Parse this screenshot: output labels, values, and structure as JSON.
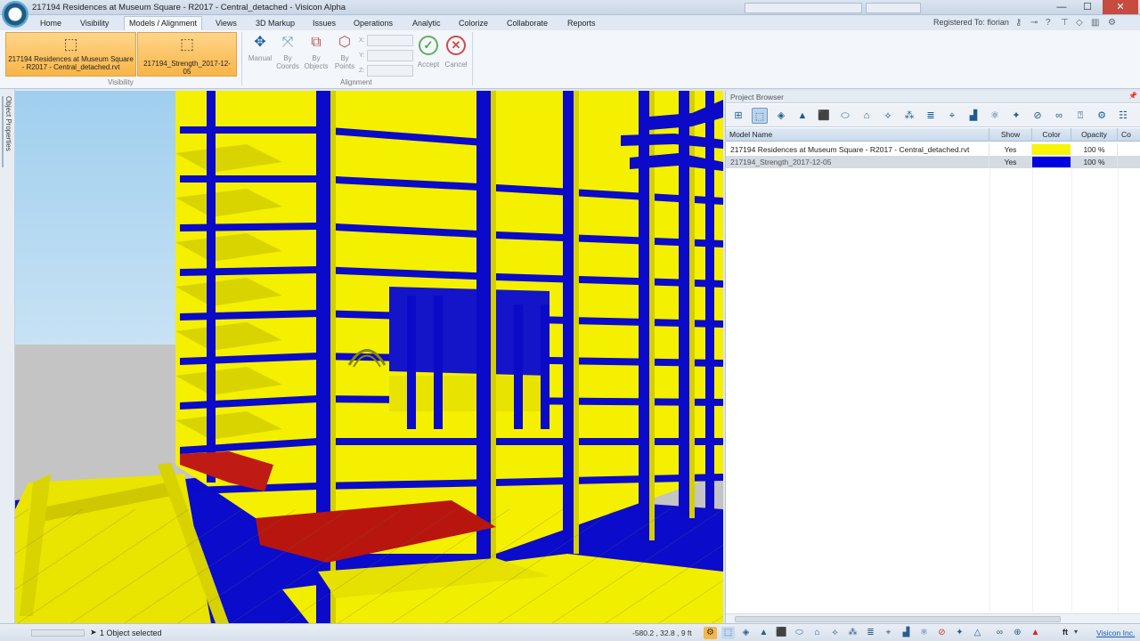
{
  "window": {
    "title": "217194 Residences at Museum Square - R2017 - Central_detached - Visicon Alpha",
    "controls": {
      "minimize": "—",
      "maximize": "☐",
      "close": "✕"
    }
  },
  "menu": {
    "tabs": [
      "Home",
      "Visibility",
      "Models / Alignment",
      "Views",
      "3D Markup",
      "Issues",
      "Operations",
      "Analytic",
      "Colorize",
      "Collaborate",
      "Reports"
    ],
    "active_tab": "Models / Alignment",
    "registered": "Registered To: florian"
  },
  "ribbon": {
    "visibility_group": {
      "label": "Visibility",
      "models": [
        "217194 Residences at Museum Square - R2017 - Central_detached.rvt",
        "217194_Strength_2017-12-05"
      ]
    },
    "alignment_group": {
      "label": "Alignment",
      "buttons": {
        "manual": "Manual",
        "by_coords": "By Coords",
        "by_objects": "By Objects",
        "by_points": "By Points"
      },
      "coord_labels": [
        "X:",
        "Y:",
        "Z:"
      ],
      "accept": "Accept",
      "cancel": "Cancel"
    }
  },
  "side_panel": {
    "label": "Object Properties"
  },
  "project_browser": {
    "title": "Project Browser",
    "columns": [
      "Model Name",
      "Show",
      "Color",
      "Opacity",
      "Co"
    ],
    "rows": [
      {
        "name": "217194 Residences at Museum Square - R2017 - Central_detached.rvt",
        "show": "Yes",
        "color": "#f7f500",
        "opacity": "100 %"
      },
      {
        "name": "217194_Strength_2017-12-05",
        "show": "Yes",
        "color": "#0000e0",
        "opacity": "100 %"
      }
    ],
    "selected_row": 1
  },
  "status": {
    "selection": "1 Object selected",
    "coords": "-580.2 , 32.8 , 9 ft",
    "unit": "ft",
    "company": "Visicon Inc."
  },
  "scene_colors": {
    "structure": "#f4f000",
    "slab_blue": "#0a0ad2",
    "highlight": "#c21a16",
    "sky": "#a8d4ee"
  }
}
